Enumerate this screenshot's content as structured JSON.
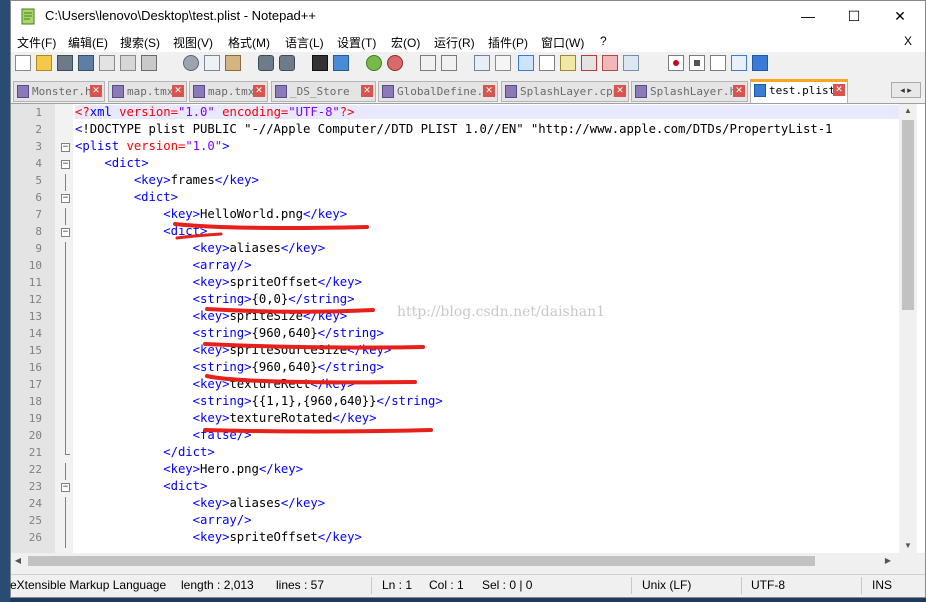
{
  "window": {
    "title": "C:\\Users\\lenovo\\Desktop\\test.plist - Notepad++",
    "minimize": "—",
    "maximize": "☐",
    "close": "✕",
    "doc_close": "X"
  },
  "menu": [
    "文件(F)",
    "编辑(E)",
    "搜索(S)",
    "视图(V)",
    "格式(M)",
    "语言(L)",
    "设置(T)",
    "宏(O)",
    "运行(R)",
    "插件(P)",
    "窗口(W)",
    "?"
  ],
  "toolbar_icons": [
    "new-file-icon",
    "open-file-icon",
    "save-icon",
    "save-all-icon",
    "close-file-icon",
    "close-all-icon",
    "print-icon",
    "cut-icon",
    "copy-icon",
    "paste-icon",
    "undo-icon",
    "redo-icon",
    "find-icon",
    "replace-icon",
    "zoom-in-icon",
    "zoom-out-icon",
    "sync-vertical-icon",
    "sync-horizontal-icon",
    "word-wrap-icon",
    "show-all-chars-icon",
    "indent-guide-icon",
    "doc-map-icon",
    "function-list-icon",
    "folder-workspace-icon",
    "monitoring-icon",
    "record-macro-icon",
    "stop-record-icon",
    "play-macro-icon",
    "run-macro-multiple-icon",
    "save-macro-icon"
  ],
  "tabs": [
    {
      "label": "Monster.h",
      "active": false
    },
    {
      "label": "map.tmx",
      "active": false
    },
    {
      "label": "map.tmx",
      "active": false
    },
    {
      "label": "_DS_Store",
      "active": false
    },
    {
      "label": "GlobalDefine.h",
      "active": false
    },
    {
      "label": "SplashLayer.cpp",
      "active": false
    },
    {
      "label": "SplashLayer.h",
      "active": false
    },
    {
      "label": "test.plist",
      "active": true
    }
  ],
  "tab_nav": "◂ ▸",
  "lines": [
    {
      "n": "1",
      "fold": "none",
      "html": "<span class='a'>&lt;?</span><span class='t'>xml</span> <span class='a'>version=</span><span class='v'>\"1.0\"</span> <span class='a'>encoding=</span><span class='v'>\"UTF-8\"</span><span class='a'>?&gt;</span>"
    },
    {
      "n": "2",
      "fold": "none",
      "html": "<span class='t'>&lt;</span><span class='p'>!DOCTYPE plist PUBLIC \"-//Apple Computer//DTD PLIST 1.0//EN\" \"http://www.apple.com/DTDs/PropertyList-1</span>"
    },
    {
      "n": "3",
      "fold": "open",
      "html": "<span class='t'>&lt;plist</span> <span class='a'>version=</span><span class='v'>\"1.0\"</span><span class='t'>&gt;</span>"
    },
    {
      "n": "4",
      "fold": "open",
      "html": "    <span class='t'>&lt;dict&gt;</span>"
    },
    {
      "n": "5",
      "fold": "line",
      "html": "        <span class='t'>&lt;key&gt;</span>frames<span class='t'>&lt;/key&gt;</span>"
    },
    {
      "n": "6",
      "fold": "open",
      "html": "        <span class='t'>&lt;dict&gt;</span>"
    },
    {
      "n": "7",
      "fold": "line",
      "html": "            <span class='t'>&lt;key&gt;</span>HelloWorld.png<span class='t'>&lt;/key&gt;</span>"
    },
    {
      "n": "8",
      "fold": "open",
      "html": "            <span class='t'>&lt;dict&gt;</span>"
    },
    {
      "n": "9",
      "fold": "line",
      "html": "                <span class='t'>&lt;key&gt;</span>aliases<span class='t'>&lt;/key&gt;</span>"
    },
    {
      "n": "10",
      "fold": "line",
      "html": "                <span class='t'>&lt;array/&gt;</span>"
    },
    {
      "n": "11",
      "fold": "line",
      "html": "                <span class='t'>&lt;key&gt;</span>spriteOffset<span class='t'>&lt;/key&gt;</span>"
    },
    {
      "n": "12",
      "fold": "line",
      "html": "                <span class='t'>&lt;string&gt;</span>{0,0}<span class='t'>&lt;/string&gt;</span>"
    },
    {
      "n": "13",
      "fold": "line",
      "html": "                <span class='t'>&lt;key&gt;</span>spriteSize<span class='t'>&lt;/key&gt;</span>"
    },
    {
      "n": "14",
      "fold": "line",
      "html": "                <span class='t'>&lt;string&gt;</span>{960,640}<span class='t'>&lt;/string&gt;</span>"
    },
    {
      "n": "15",
      "fold": "line",
      "html": "                <span class='t'>&lt;key&gt;</span>spriteSourceSize<span class='t'>&lt;/key&gt;</span>"
    },
    {
      "n": "16",
      "fold": "line",
      "html": "                <span class='t'>&lt;string&gt;</span>{960,640}<span class='t'>&lt;/string&gt;</span>"
    },
    {
      "n": "17",
      "fold": "line",
      "html": "                <span class='t'>&lt;key&gt;</span>textureRect<span class='t'>&lt;/key&gt;</span>"
    },
    {
      "n": "18",
      "fold": "line",
      "html": "                <span class='t'>&lt;string&gt;</span>{{1,1},{960,640}}<span class='t'>&lt;/string&gt;</span>"
    },
    {
      "n": "19",
      "fold": "line",
      "html": "                <span class='t'>&lt;key&gt;</span>textureRotated<span class='t'>&lt;/key&gt;</span>"
    },
    {
      "n": "20",
      "fold": "line",
      "html": "                <span class='t'>&lt;false/&gt;</span>"
    },
    {
      "n": "21",
      "fold": "end",
      "html": "            <span class='t'>&lt;/dict&gt;</span>"
    },
    {
      "n": "22",
      "fold": "line",
      "html": "            <span class='t'>&lt;key&gt;</span>Hero.png<span class='t'>&lt;/key&gt;</span>"
    },
    {
      "n": "23",
      "fold": "open",
      "html": "            <span class='t'>&lt;dict&gt;</span>"
    },
    {
      "n": "24",
      "fold": "line",
      "html": "                <span class='t'>&lt;key&gt;</span>aliases<span class='t'>&lt;/key&gt;</span>"
    },
    {
      "n": "25",
      "fold": "line",
      "html": "                <span class='t'>&lt;array/&gt;</span>"
    },
    {
      "n": "26",
      "fold": "line",
      "html": "                <span class='t'>&lt;key&gt;</span>spriteOffset<span class='t'>&lt;/key&gt;</span>"
    }
  ],
  "watermark": "http://blog.csdn.net/daishan1",
  "status": {
    "language": "eXtensible Markup Language",
    "length": "length : 2,013",
    "lines": "lines : 57",
    "ln": "Ln : 1",
    "col": "Col : 1",
    "sel": "Sel : 0 | 0",
    "eol": "Unix (LF)",
    "encoding": "UTF-8",
    "mode": "INS"
  },
  "colors": {
    "tag": "#0000ff",
    "attr": "#ff0000",
    "value": "#8000ff",
    "annotation": "#e8201c",
    "active_tab_accent": "#f5a623"
  }
}
